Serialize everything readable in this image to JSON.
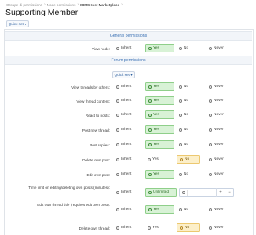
{
  "breadcrumbs": [
    "Groupe di permissions",
    "Node permissions",
    "MIMSHost Marketplace"
  ],
  "page_title": "Supporting Member",
  "quick_set_label": "Quick set",
  "sections": {
    "general": "General permissions",
    "forum": "Forum permissions"
  },
  "option_labels": {
    "inherit": "Inherit",
    "yes": "Yes",
    "no": "No",
    "never": "Never",
    "unlimited": "Unlimited"
  },
  "stepper": {
    "minus": "−",
    "plus": "+"
  },
  "colors": {
    "yes_bg": "#d8f2d6",
    "no_bg": "#fcefc9",
    "accent": "#3d73b5"
  },
  "general_rows": [
    {
      "label": "View node:",
      "selected": "yes"
    }
  ],
  "forum_rows": [
    {
      "label": "View threads by others:",
      "selected": "yes"
    },
    {
      "label": "View thread content:",
      "selected": "yes"
    },
    {
      "label": "React to posts:",
      "selected": "yes"
    },
    {
      "label": "Post new thread:",
      "selected": "yes"
    },
    {
      "label": "Post replies:",
      "selected": "yes"
    },
    {
      "label": "Delete own post:",
      "selected": "no"
    },
    {
      "label": "Edit own post:",
      "selected": "yes"
    },
    {
      "label": "Time limit on editing/deleting own posts (minutes):",
      "selected": "unlimited"
    },
    {
      "label": "Edit own thread title (requires edit own post):",
      "selected": "yes"
    },
    {
      "label": "Delete own thread:",
      "selected": "no"
    }
  ]
}
